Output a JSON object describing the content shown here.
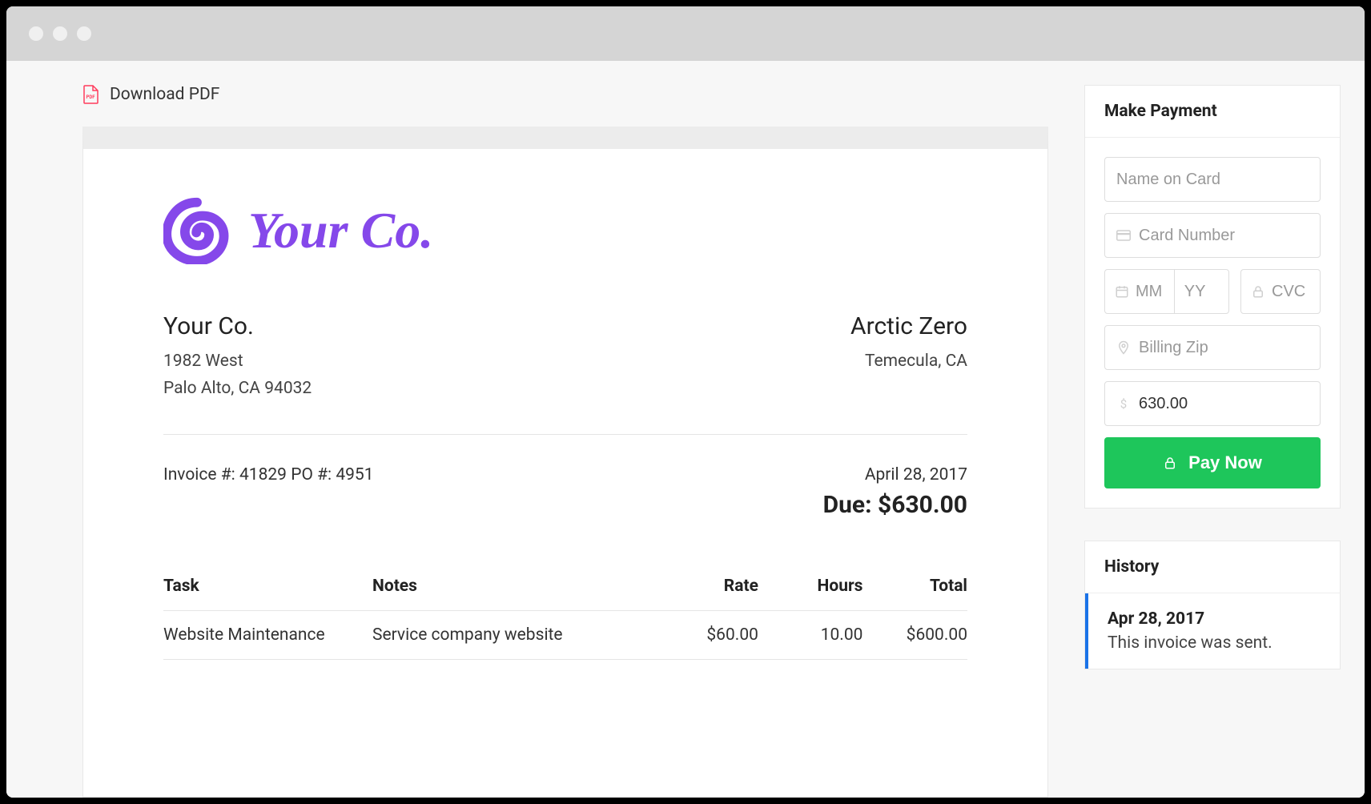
{
  "download": {
    "label": "Download PDF"
  },
  "logo": {
    "text": "Your Co."
  },
  "from": {
    "name": "Your Co.",
    "line1": "1982 West",
    "line2": "Palo Alto, CA 94032"
  },
  "to": {
    "name": "Arctic Zero",
    "line1": "Temecula, CA"
  },
  "meta": {
    "invoice_po": "Invoice #: 41829 PO #: 4951",
    "date": "April 28, 2017",
    "due": "Due: $630.00"
  },
  "table": {
    "headers": {
      "task": "Task",
      "notes": "Notes",
      "rate": "Rate",
      "hours": "Hours",
      "total": "Total"
    },
    "rows": [
      {
        "task": "Website Maintenance",
        "notes": "Service company website",
        "rate": "$60.00",
        "hours": "10.00",
        "total": "$600.00"
      }
    ]
  },
  "payment": {
    "title": "Make Payment",
    "name_placeholder": "Name on Card",
    "card_placeholder": "Card Number",
    "mm_placeholder": "MM",
    "yy_placeholder": "YY",
    "cvc_placeholder": "CVC",
    "zip_placeholder": "Billing Zip",
    "amount_value": "630.00",
    "button": "Pay Now"
  },
  "history": {
    "title": "History",
    "items": [
      {
        "date": "Apr 28, 2017",
        "text": "This invoice was sent."
      }
    ]
  }
}
